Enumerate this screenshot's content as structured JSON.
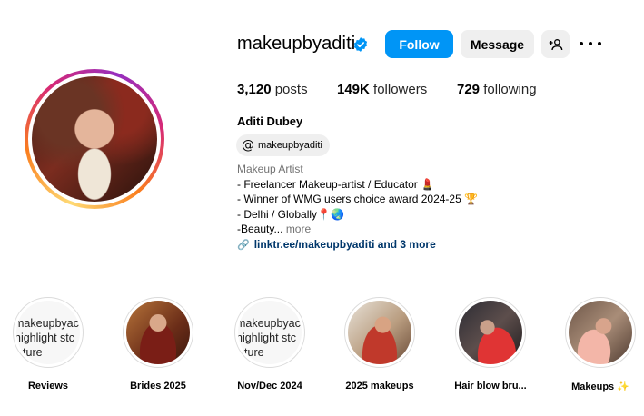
{
  "profile": {
    "username": "makeupbyaditi",
    "full_name": "Aditi Dubey",
    "threads_handle": "makeupbyaditi",
    "category": "Makeup Artist",
    "bio_lines": [
      "- Freelancer Makeup-artist / Educator 💄",
      "- Winner of WMG users choice award 2024-25 🏆",
      "- Delhi / Globally📍🌏",
      "-Beauty... "
    ],
    "bio_more": "more",
    "link_text": "linktr.ee/makeupbyaditi and 3 more"
  },
  "actions": {
    "follow": "Follow",
    "message": "Message"
  },
  "stats": {
    "posts_count": "3,120",
    "posts_label": "posts",
    "followers_count": "149K",
    "followers_label": "followers",
    "following_count": "729",
    "following_label": "following"
  },
  "highlights": [
    {
      "label": "Reviews",
      "placeholder_lines": [
        "makeupbyac",
        "highlight stc",
        "icture"
      ]
    },
    {
      "label": "Brides 2025"
    },
    {
      "label": "Nov/Dec 2024",
      "placeholder_lines": [
        "makeupbyac",
        "highlight stc",
        "icture"
      ]
    },
    {
      "label": "2025 makeups"
    },
    {
      "label": "Hair blow bru..."
    },
    {
      "label": "Makeups ✨"
    }
  ],
  "colors": {
    "follow_button": "#0095f6",
    "secondary_button": "#efefef",
    "link": "#00376b",
    "verified_badge": "#0095f6",
    "muted_text": "#737373"
  }
}
